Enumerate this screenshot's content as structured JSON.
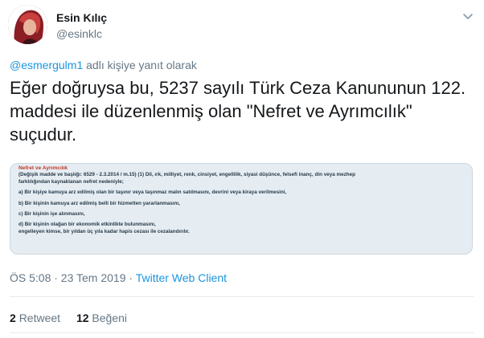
{
  "author": {
    "name": "Esin Kılıç",
    "handle": "@esinklc"
  },
  "reply": {
    "mention": "@esmergulm1",
    "suffix": " adlı kişiye yanıt olarak"
  },
  "tweet_text": "Eğer doğruysa bu, 5237  sayılı Türk Ceza Kanununun 122. maddesi ile düzenlenmiş olan \"Nefret ve Ayrımcılık\" suçudur.",
  "media": {
    "title": "Nefret ve Ayrımcılık",
    "lines": [
      "(Değişik madde ve başlığı: 6529 - 2.3.2014 / m.15) (1) Dil, ırk, milliyet, renk, cinsiyet, engellilik, siyasi düşünce, felsefi inanç, din veya mezhep",
      "farklılığından kaynaklanan nefret nedeniyle;",
      "a) Bir kişiye kamuya arz edilmiş olan bir taşınır veya taşınmaz malın satılmasını, devrini veya kiraya verilmesini,",
      "b) Bir kişinin kamuya arz edilmiş belli bir hizmetten yararlanmasını,",
      "c) Bir kişinin işe alınmasını,",
      "d) Bir kişinin olağan bir ekonomik etkinlikte bulunmasını,",
      "engelleyen kimse, bir yıldan üç yıla kadar hapis cezası ile cezalandırılır."
    ]
  },
  "meta": {
    "timestamp": "ÖS 5:08 · 23 Tem 2019 · ",
    "client": "Twitter Web Client"
  },
  "stats": {
    "retweet_count": "2",
    "retweet_label": "Retweet",
    "like_count": "12",
    "like_label": "Beğeni"
  },
  "colors": {
    "link": "#1b95e0",
    "secondary": "#657786",
    "primary": "#14171a",
    "media_title": "#c0392b"
  },
  "icons": [
    "chevron-down-icon"
  ]
}
